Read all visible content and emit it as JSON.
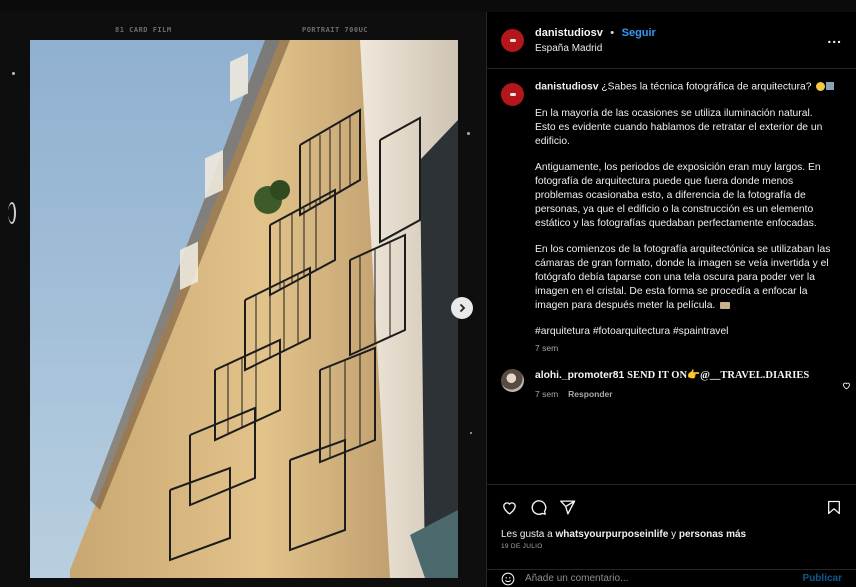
{
  "film": {
    "brand": "81  CARD FILM",
    "stock": "PORTRAIT 700UC"
  },
  "post": {
    "username": "danistudiosv",
    "separator": "•",
    "follow_label": "Seguir",
    "location": "España Madrid",
    "more_label": "..."
  },
  "caption": {
    "username": "danistudiosv",
    "lead": "¿Sabes la técnica fotográfica de arquitectura?",
    "paragraphs": [
      "En la mayoría de las ocasiones se utiliza iluminación natural. Esto es evidente cuando hablamos de retratar el exterior de un edificio.",
      "Antiguamente, los periodos de exposición eran muy largos. En fotografía de arquitectura puede que fuera donde menos problemas ocasionaba esto, a diferencia de la fotografía de personas, ya que el edificio o la construcción es un elemento estático y las fotografías quedaban perfectamente enfocadas.",
      "En los comienzos de la fotografía arquitectónica se utilizaban las cámaras de gran formato, donde la imagen se veía invertida y el fotógrafo debía taparse con una tela oscura para poder ver la imagen en el cristal. De esta forma se procedía a enfocar la imagen para después meter la película."
    ],
    "hashtags": "#arquitetura #fotoarquitectura #spaintravel",
    "time": "7 sem"
  },
  "comment": {
    "username": "alohi._promoter81",
    "text": "SEND IT ON👉@__TRAVEL.DIARIES",
    "time": "7 sem",
    "reply_label": "Responder"
  },
  "likes": {
    "prefix": "Les gusta a",
    "user": "whatsyourpurposeinlife",
    "connector": "y",
    "others": "personas más",
    "date": "19 DE JULIO"
  },
  "add_comment": {
    "placeholder": "Añade un comentario...",
    "publish_label": "Publicar"
  },
  "icons": [
    "heart-icon",
    "comment-icon",
    "share-icon",
    "bookmark-icon",
    "emoji-icon",
    "next-arrow-icon",
    "more-icon"
  ],
  "colors": {
    "accent": "#2f9df7",
    "publish": "#0c5a8f",
    "avatar": "#b3171b",
    "background": "#000000"
  }
}
